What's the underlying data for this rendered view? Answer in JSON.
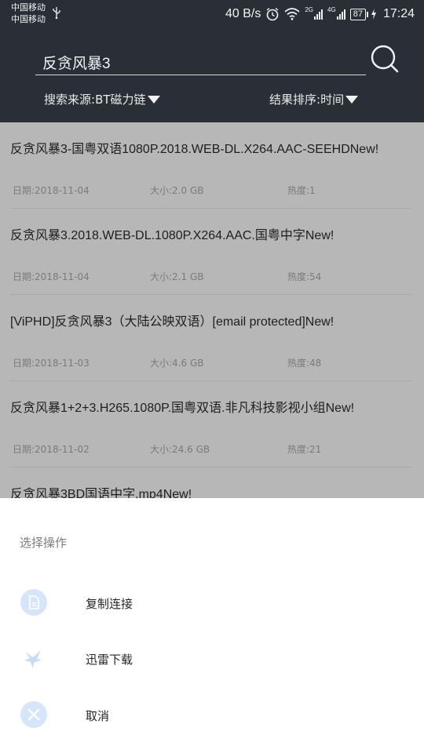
{
  "status_bar": {
    "carrier_1": "中国移动",
    "carrier_2": "中国移动",
    "net_speed": "40 B/s",
    "net_2g": "2G",
    "net_4g": "4G",
    "battery": "87",
    "time": "17:24"
  },
  "search": {
    "query": "反贪风暴3",
    "icon": "search-icon"
  },
  "filters": {
    "source_label": "搜索来源:",
    "source_value": "BT磁力链",
    "sort_label": "结果排序:",
    "sort_value": "时间"
  },
  "results": [
    {
      "title": "反贪风暴3-国粤双语1080P.2018.WEB-DL.X264.AAC-SEEHDNew!",
      "date": "日期:2018-11-04",
      "size": "大小:2.0 GB",
      "heat": "热度:1"
    },
    {
      "title": "反贪风暴3.2018.WEB-DL.1080P.X264.AAC.国粤中字New!",
      "date": "日期:2018-11-04",
      "size": "大小:2.1 GB",
      "heat": "热度:54"
    },
    {
      "title": "[ViPHD]反贪风暴3（大陆公映双语）[email protected]New!",
      "date": "日期:2018-11-03",
      "size": "大小:4.6 GB",
      "heat": "热度:48"
    },
    {
      "title": "反贪风暴1+2+3.H265.1080P.国粤双语.非凡科技影视小组New!",
      "date": "日期:2018-11-02",
      "size": "大小:24.6 GB",
      "heat": "热度:21"
    },
    {
      "title": "反贪风暴3BD国语中字.mp4New!",
      "date": "",
      "size": "",
      "heat": ""
    }
  ],
  "sheet": {
    "title": "选择操作",
    "actions": [
      {
        "label": "复制连接",
        "icon": "copy-file-icon"
      },
      {
        "label": "迅雷下载",
        "icon": "thunder-bird-icon"
      },
      {
        "label": "取消",
        "icon": "close-icon"
      }
    ]
  },
  "colors": {
    "header_bg": "#2a2f37",
    "dim_overlay_list": "#b7b7b7",
    "icon_accent": "#d6e6f8"
  }
}
